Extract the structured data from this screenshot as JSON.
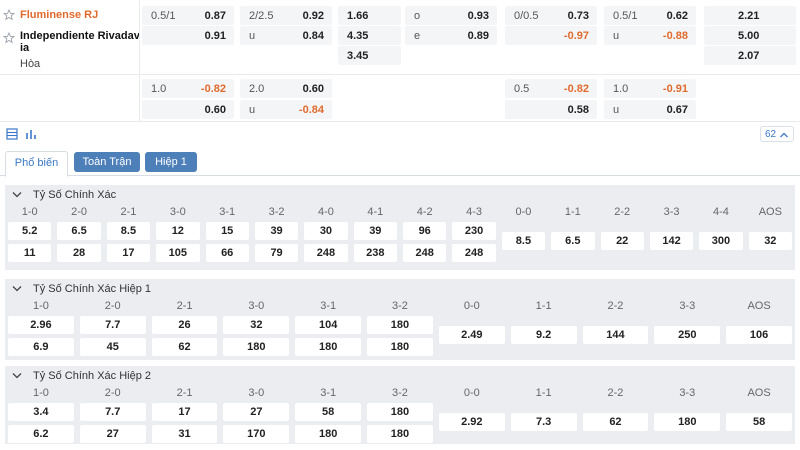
{
  "match": {
    "team1": "Fluminense RJ",
    "team2_line1": "Independiente Rivadav",
    "team2_line2": "ia",
    "draw": "Hòa"
  },
  "top_rows": {
    "row1": [
      {
        "l": "0.5/1",
        "r": "0.87"
      },
      {
        "l": "2/2.5",
        "r": "0.92"
      },
      {
        "c": "1.66"
      },
      {
        "l": "o",
        "r": "0.93"
      },
      {
        "l": "0/0.5",
        "r": "0.73"
      },
      {
        "l": "0.5/1",
        "r": "0.62"
      },
      {
        "c": "2.21"
      }
    ],
    "row2": [
      {
        "r": "0.91"
      },
      {
        "l": "u",
        "r": "0.84"
      },
      {
        "c": "4.35"
      },
      {
        "l": "e",
        "r": "0.89"
      },
      {
        "r": "-0.97"
      },
      {
        "l": "u",
        "r": "-0.88"
      },
      {
        "c": "5.00"
      }
    ],
    "row3": [
      {
        "c": "3.45"
      },
      {
        "c": "2.07"
      }
    ],
    "row4": [
      {
        "l": "1.0",
        "r": "-0.82"
      },
      {
        "l": "2.0",
        "r": "0.60"
      },
      {
        "l": "0.5",
        "r": "-0.82"
      },
      {
        "l": "1.0",
        "r": "-0.91"
      }
    ],
    "row5": [
      {
        "r": "0.60"
      },
      {
        "l": "u",
        "r": "-0.84"
      },
      {
        "r": "0.58"
      },
      {
        "l": "u",
        "r": "0.67"
      }
    ]
  },
  "toolbar": {
    "count": "62"
  },
  "tabs": [
    "Phổ biến",
    "Toàn Trận",
    "Hiệp 1"
  ],
  "colors": {
    "accent": "#3a78c6",
    "negative": "#e06a2c",
    "tab_button": "#4d7fb9",
    "section_bg": "#ebedf1"
  },
  "sections": [
    {
      "title": "Tỷ Số Chính Xác",
      "home_headers": [
        "1-0",
        "2-0",
        "2-1",
        "3-0",
        "3-1",
        "3-2",
        "4-0",
        "4-1",
        "4-2",
        "4-3"
      ],
      "home_row1": [
        "5.2",
        "6.5",
        "8.5",
        "12",
        "15",
        "39",
        "30",
        "39",
        "96",
        "230"
      ],
      "home_row2": [
        "11",
        "28",
        "17",
        "105",
        "66",
        "79",
        "248",
        "238",
        "248",
        "248"
      ],
      "draw_headers": [
        "0-0",
        "1-1",
        "2-2",
        "3-3",
        "4-4",
        "AOS"
      ],
      "draw_values": [
        "8.5",
        "6.5",
        "22",
        "142",
        "300",
        "32"
      ]
    },
    {
      "title": "Tỷ Số Chính Xác Hiệp 1",
      "home_headers": [
        "1-0",
        "2-0",
        "2-1",
        "3-0",
        "3-1",
        "3-2"
      ],
      "home_row1": [
        "2.96",
        "7.7",
        "26",
        "32",
        "104",
        "180"
      ],
      "home_row2": [
        "6.9",
        "45",
        "62",
        "180",
        "180",
        "180"
      ],
      "draw_headers": [
        "0-0",
        "1-1",
        "2-2",
        "3-3",
        "AOS"
      ],
      "draw_values": [
        "2.49",
        "9.2",
        "144",
        "250",
        "106"
      ]
    },
    {
      "title": "Tỷ Số Chính Xác Hiệp 2",
      "home_headers": [
        "1-0",
        "2-0",
        "2-1",
        "3-0",
        "3-1",
        "3-2"
      ],
      "home_row1": [
        "3.4",
        "7.7",
        "17",
        "27",
        "58",
        "180"
      ],
      "home_row2": [
        "6.2",
        "27",
        "31",
        "170",
        "180",
        "180"
      ],
      "draw_headers": [
        "0-0",
        "1-1",
        "2-2",
        "3-3",
        "AOS"
      ],
      "draw_values": [
        "2.92",
        "7.3",
        "62",
        "180",
        "58"
      ]
    }
  ]
}
